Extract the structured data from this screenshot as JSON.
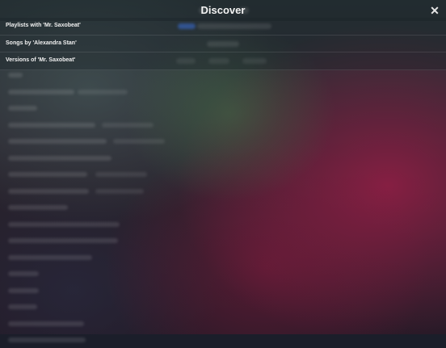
{
  "header": {
    "title": "Discover",
    "close_label": "✕"
  },
  "menu": {
    "items": [
      {
        "label": "Playlists with 'Mr. Saxobeat'"
      },
      {
        "label": "Songs by 'Alexandra Stan'"
      },
      {
        "label": "Versions of 'Mr. Saxobeat'"
      }
    ]
  },
  "colors": {
    "text": "#f0f0f0",
    "accent": "#3a6fd8"
  }
}
